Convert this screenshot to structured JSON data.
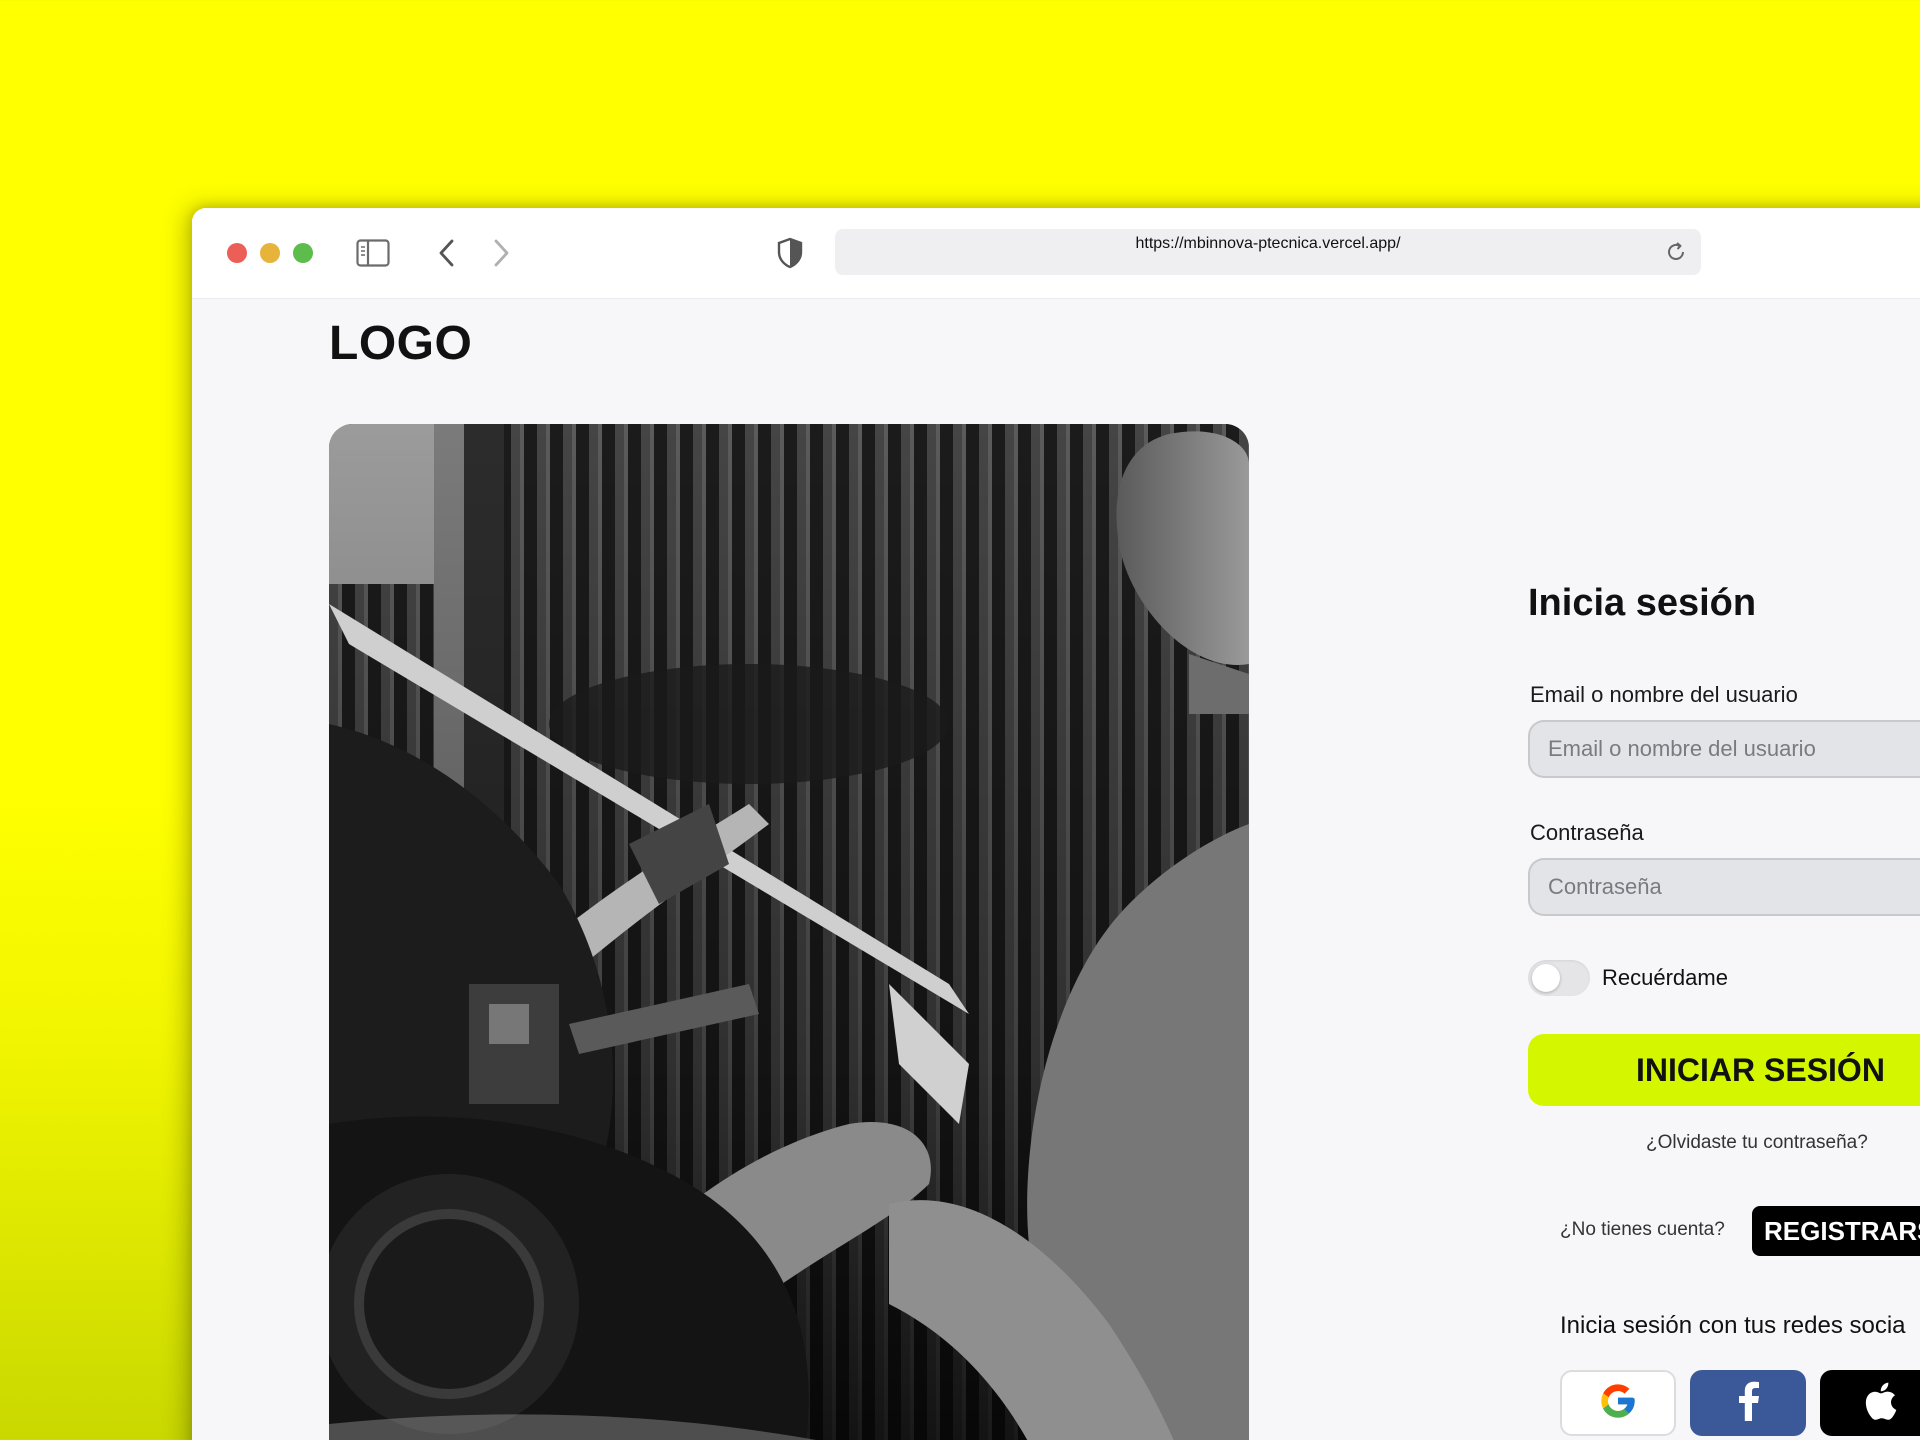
{
  "browser": {
    "url": "https://mbinnova-ptecnica.vercel.app/"
  },
  "page": {
    "logo": "LOGO",
    "hero_image": "mechanic-working-on-motorcycle-photo"
  },
  "login": {
    "title": "Inicia sesión",
    "email_label": "Email o nombre del usuario",
    "email_placeholder": "Email o nombre del usuario",
    "password_label": "Contraseña",
    "password_placeholder": "Contraseña",
    "remember_label": "Recuérdame",
    "remember_checked": false,
    "submit_label": "INICIAR SESIÓN",
    "forgot_link": "¿Olvidaste tu contraseña?",
    "no_account_text": "¿No tienes cuenta?",
    "register_label": "REGISTRARS",
    "social_heading": "Inicia sesión con tus redes socia",
    "social_buttons": [
      "google-icon",
      "facebook-icon",
      "apple-icon"
    ]
  },
  "colors": {
    "background": "#ffff00",
    "accent_button": "#d4f700",
    "facebook": "#3b5998"
  }
}
